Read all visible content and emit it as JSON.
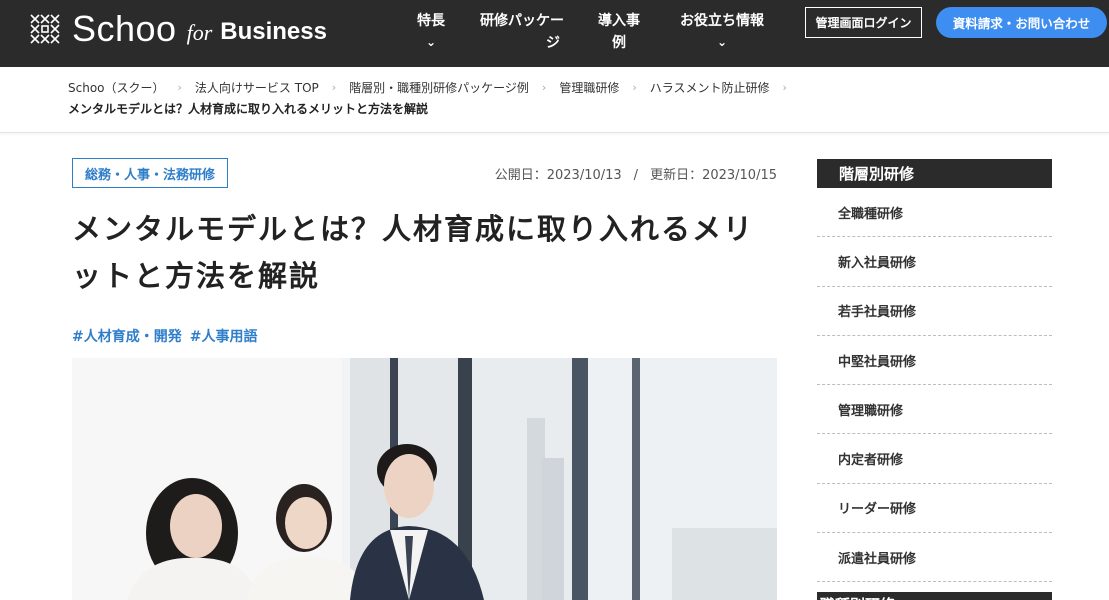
{
  "header": {
    "logo": {
      "schoo": "Schoo",
      "for": "for",
      "business": "Business"
    },
    "nav": [
      {
        "label": "特長",
        "has_dropdown": true
      },
      {
        "label": "研修パッケー",
        "label2": "ジ",
        "has_dropdown": false
      },
      {
        "label": "導入事",
        "label2": "例",
        "has_dropdown": false
      },
      {
        "label": "お役立ち情報",
        "has_dropdown": true
      }
    ],
    "dropdown_glyph": "⌄",
    "login_button": "管理画面ログイン",
    "contact_button": "資料請求・お問い合わせ"
  },
  "breadcrumb": {
    "items": [
      "Schoo（スクー）",
      "法人向けサービス TOP",
      "階層別・職種別研修パッケージ例",
      "管理職研修",
      "ハラスメント防止研修"
    ],
    "separator": "›",
    "current": "メンタルモデルとは？人材育成に取り入れるメリットと方法を解説"
  },
  "article": {
    "category": "総務・人事・法務研修",
    "published_label": "公開日：2023/10/13",
    "updated_label": "更新日：2023/10/15",
    "date_separator": "/",
    "title": "メンタルモデルとは？人材育成に取り入れるメリットと方法を解説",
    "tags": [
      "#人材育成・開発",
      "#人事用語"
    ]
  },
  "sidebar": {
    "heading": "階層別研修",
    "items": [
      "全職種研修",
      "新入社員研修",
      "若手社員研修",
      "中堅社員研修",
      "管理職研修",
      "内定者研修",
      "リーダー研修",
      "派遣社員研修"
    ],
    "heading2": "職種別研修"
  },
  "colors": {
    "header_bg": "#2b2b2b",
    "accent_blue": "#2f7ec9",
    "contact_button": "#3d8ef0"
  }
}
